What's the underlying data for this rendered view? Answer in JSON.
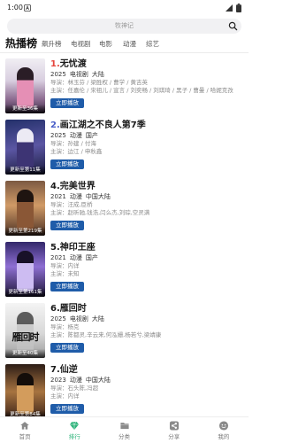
{
  "status_bar": {
    "time": "1:00"
  },
  "search": {
    "placeholder": "牧神记"
  },
  "tabs": [
    {
      "label": "热播榜",
      "active": true
    },
    {
      "label": "飙升榜",
      "active": false
    },
    {
      "label": "电视剧",
      "active": false
    },
    {
      "label": "电影",
      "active": false
    },
    {
      "label": "动漫",
      "active": false
    },
    {
      "label": "综艺",
      "active": false
    }
  ],
  "labels": {
    "director": "导演：",
    "cast": "主演："
  },
  "list": [
    {
      "rank": "1.",
      "rank_color": "#e5453c",
      "title": "无忧渡",
      "year": "2025",
      "category": "电视剧",
      "region": "大陆",
      "director": "林玉芬 / 梁胜权 / 曹学 / 黄吉英",
      "cast": "任嘉伦 / 宋祖儿 / 宣言 / 刘奕畅 / 刘琪琦 / 黑子 / 曹曼 / 哈妮克孜",
      "badge": "更新至36集",
      "play_label": "立即播放"
    },
    {
      "rank": "2.",
      "rank_color": "#4a5fc8",
      "title": "画江湖之不良人第7季",
      "year": "2025",
      "category": "动漫",
      "region": "国产",
      "director": "孙建 / 付海",
      "cast": "边江 / 申秋鑫",
      "badge": "更新至第11集",
      "play_label": "立即播放"
    },
    {
      "rank": "4.",
      "title": "完美世界",
      "year": "2021",
      "category": "动漫",
      "region": "中国大陆",
      "director": "汪成,臣桥",
      "cast": "赵昕驰,钱浩,闫么杰,刘琮,空灵满",
      "badge": "更新至第219集",
      "play_label": "立即播放"
    },
    {
      "rank": "5.",
      "title": "神印王座",
      "year": "2021",
      "category": "动漫",
      "region": "国产",
      "director": "内详",
      "cast": "未知",
      "badge": "更新至第161集",
      "play_label": "立即播放"
    },
    {
      "rank": "6.",
      "title": "雁回时",
      "year": "2025",
      "category": "电视剧",
      "region": "大陆",
      "director": "杨克",
      "cast": "陈都灵,辛云来,何泓姗,杨若兮,梁靖康",
      "badge": "更新至40集",
      "poster_text": "雁回时",
      "play_label": "立即播放"
    },
    {
      "rank": "7.",
      "title": "仙逆",
      "year": "2023",
      "category": "动漫",
      "region": "中国大陆",
      "director": "石头陈,冯超",
      "cast": "内详",
      "badge": "更新至第84集",
      "play_label": "立即播放"
    }
  ],
  "nav": [
    {
      "label": "首页",
      "icon": "home-icon",
      "active": false
    },
    {
      "label": "排行",
      "icon": "ranking-icon",
      "active": true
    },
    {
      "label": "分类",
      "icon": "folder-icon",
      "active": false
    },
    {
      "label": "分享",
      "icon": "share-icon",
      "active": false
    },
    {
      "label": "我的",
      "icon": "profile-icon",
      "active": false
    }
  ],
  "colors": {
    "accent": "#2db37a",
    "play_button": "#1f5ca9",
    "rank_first": "#e5453c",
    "rank_second": "#4a5fc8"
  }
}
